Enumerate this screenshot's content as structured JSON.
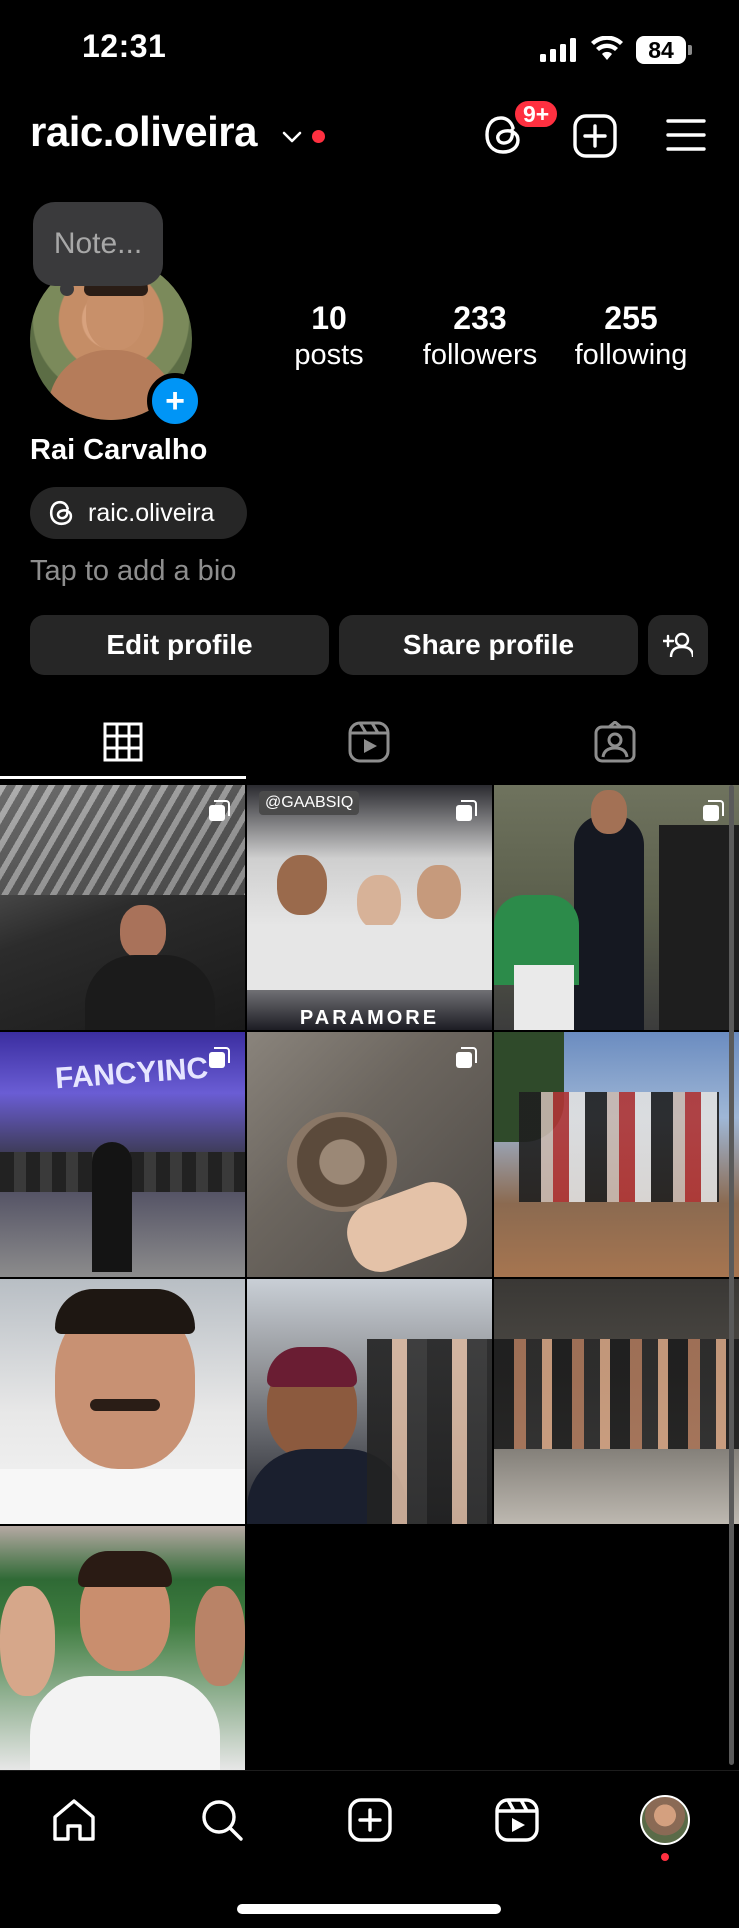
{
  "status_bar": {
    "time": "12:31",
    "battery": "84"
  },
  "header": {
    "username": "raic.oliveira",
    "threads_badge": "9+"
  },
  "note": {
    "placeholder": "Note..."
  },
  "profile": {
    "full_name": "Rai Carvalho",
    "threads_handle": "raic.oliveira",
    "bio_placeholder": "Tap to add a bio",
    "stats": [
      {
        "value": "10",
        "label": "posts"
      },
      {
        "value": "233",
        "label": "followers"
      },
      {
        "value": "255",
        "label": "following"
      }
    ]
  },
  "actions": {
    "edit_label": "Edit profile",
    "share_label": "Share profile"
  },
  "tabs": [
    "grid-icon",
    "reels-icon",
    "tagged-icon"
  ],
  "grid": {
    "posts": [
      {
        "scene": "roof-selfie",
        "multi": true
      },
      {
        "scene": "group-selfie-paramore",
        "multi": true,
        "watermark": "@GAABSIQ",
        "caption": "PARAMORE"
      },
      {
        "scene": "suits-party",
        "multi": true
      },
      {
        "scene": "festival-fancyinc",
        "multi": true,
        "sign": "FANCYINC"
      },
      {
        "scene": "kitten",
        "multi": true
      },
      {
        "scene": "group-outdoor",
        "multi": false
      },
      {
        "scene": "selfie-close",
        "multi": false
      },
      {
        "scene": "beach-group-selfie",
        "multi": false
      },
      {
        "scene": "group-night-floor",
        "multi": false
      },
      {
        "scene": "stadium-selfie",
        "multi": false
      }
    ]
  },
  "nav": [
    "home-icon",
    "search-icon",
    "create-icon",
    "reels-icon",
    "profile-avatar"
  ],
  "colors": {
    "accent_blue": "#0095f6",
    "badge_red": "#ff3040",
    "chip_gray": "#262626"
  }
}
